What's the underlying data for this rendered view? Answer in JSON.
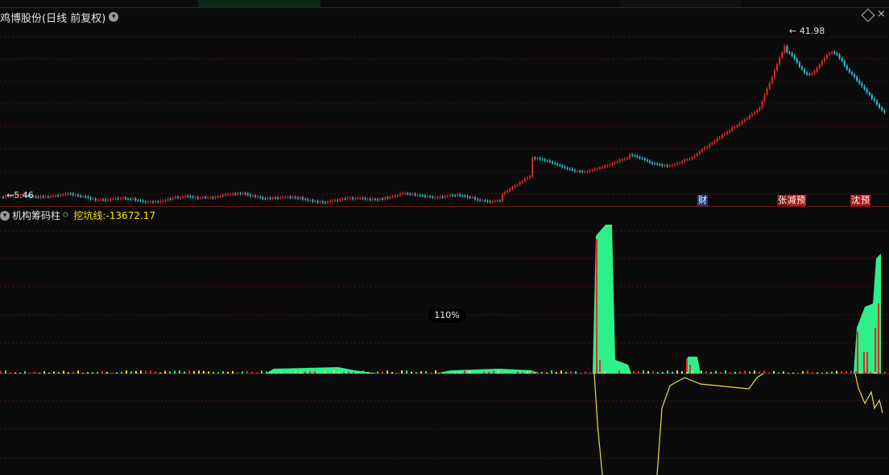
{
  "main": {
    "title": "鸡博股份(日线 前复权)",
    "high_label": "41.98",
    "low_label": "5.46",
    "badges": [
      {
        "text": "财",
        "color": "#1a3a7a"
      },
      {
        "text": "张",
        "color": "#7a1515"
      },
      {
        "text": "减",
        "color": "#b01818"
      },
      {
        "text": "预",
        "color": "#b01818"
      },
      {
        "text": "沈",
        "color": "#b01818"
      },
      {
        "text": "预",
        "color": "#b01818"
      }
    ]
  },
  "indicator": {
    "name": "机构筹码柱",
    "star": "✩",
    "line_label": "挖坑线:",
    "line_value": "-13672.17"
  },
  "zoom": "110%",
  "colors": {
    "up": "#e02a2a",
    "down": "#2ac8d8",
    "green_area": "#2ef08a",
    "yellow_line": "#e8e040",
    "grid": "#5a1010"
  },
  "icons": [
    "chevron-down-icon",
    "diamond-icon",
    "close-icon",
    "arrow-left-icon",
    "star-icon"
  ]
}
